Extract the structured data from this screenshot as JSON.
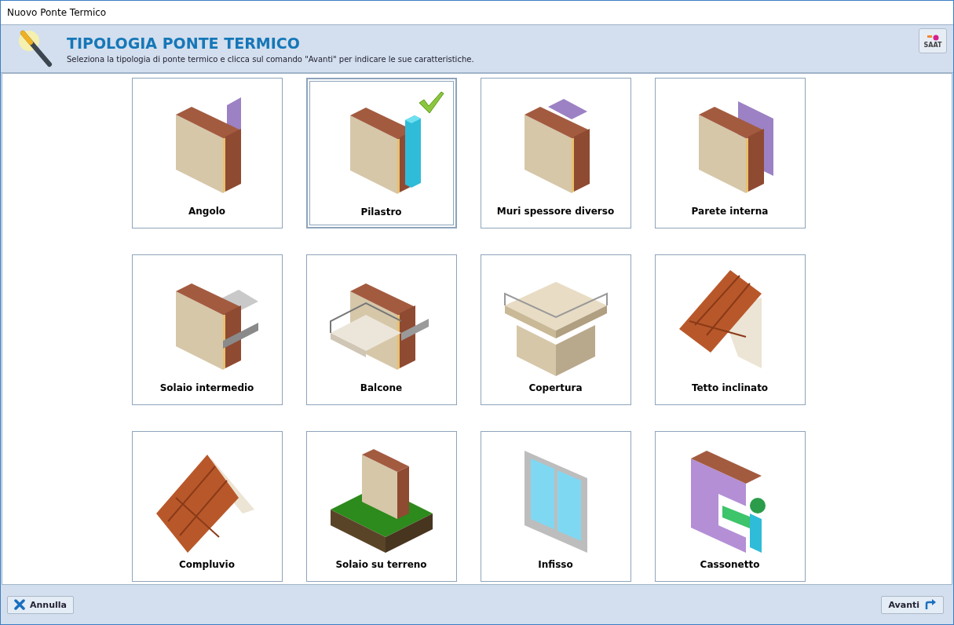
{
  "window": {
    "title": "Nuovo Ponte Termico"
  },
  "header": {
    "title": "TIPOLOGIA PONTE TERMICO",
    "subtitle": "Seleziona la tipologia di ponte termico e clicca sul comando \"Avanti\" per indicare le sue caratteristiche.",
    "logo_text": "SAAT"
  },
  "tiles": [
    {
      "label": "Angolo",
      "kind": "corner",
      "selected": false
    },
    {
      "label": "Pilastro",
      "kind": "pillar",
      "selected": true
    },
    {
      "label": "Muri spessore diverso",
      "kind": "step",
      "selected": false
    },
    {
      "label": "Parete interna",
      "kind": "inner",
      "selected": false
    },
    {
      "label": "Solaio intermedio",
      "kind": "slab",
      "selected": false
    },
    {
      "label": "Balcone",
      "kind": "balcony",
      "selected": false
    },
    {
      "label": "Copertura",
      "kind": "flatroof",
      "selected": false
    },
    {
      "label": "Tetto inclinato",
      "kind": "pitched",
      "selected": false
    },
    {
      "label": "Compluvio",
      "kind": "valley",
      "selected": false
    },
    {
      "label": "Solaio su terreno",
      "kind": "ground",
      "selected": false
    },
    {
      "label": "Infisso",
      "kind": "window",
      "selected": false
    },
    {
      "label": "Cassonetto",
      "kind": "shutterbox",
      "selected": false
    }
  ],
  "buttons": {
    "cancel": "Annulla",
    "next": "Avanti"
  }
}
